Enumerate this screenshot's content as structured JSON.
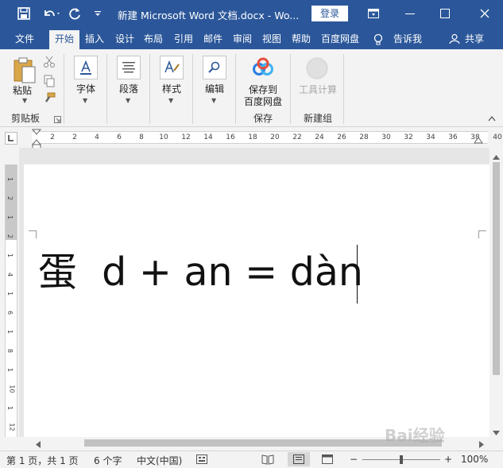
{
  "titlebar": {
    "title": "新建 Microsoft Word 文档.docx  -  Wo...",
    "login_label": "登录"
  },
  "ribbon_tabs": [
    "文件",
    "开始",
    "插入",
    "设计",
    "布局",
    "引用",
    "邮件",
    "审阅",
    "视图",
    "帮助",
    "百度网盘",
    "告诉我",
    "共享"
  ],
  "ribbon": {
    "paste_label": "粘贴",
    "clipboard_group": "剪贴板",
    "font_label": "字体",
    "paragraph_label": "段落",
    "styles_label": "样式",
    "editing_label": "编辑",
    "save_baidu_line1": "保存到",
    "save_baidu_line2": "百度网盘",
    "save_group": "保存",
    "tool_calc_label": "工具计算",
    "new_group": "新建组"
  },
  "ruler": {
    "h_ticks": [
      "2",
      "2",
      "4",
      "6",
      "8",
      "10",
      "12",
      "14",
      "16",
      "18",
      "20",
      "22",
      "24",
      "26",
      "28",
      "30",
      "32",
      "34",
      "36",
      "38",
      "40"
    ],
    "v_ticks": [
      "1",
      "2",
      "1",
      "2",
      "1",
      "4",
      "1",
      "6",
      "1",
      "8",
      "1",
      "10",
      "1",
      "12"
    ]
  },
  "document": {
    "text": "蛋  d + an = dàn"
  },
  "statusbar": {
    "page": "第 1 页，共 1 页",
    "words": "6 个字",
    "language": "中文(中国)",
    "zoom": "100%",
    "zoom_minus": "−",
    "zoom_plus": "+"
  },
  "watermark": "Bai经验",
  "colors": {
    "accent": "#2b579a",
    "baidu_blue": "#2a7de1"
  }
}
